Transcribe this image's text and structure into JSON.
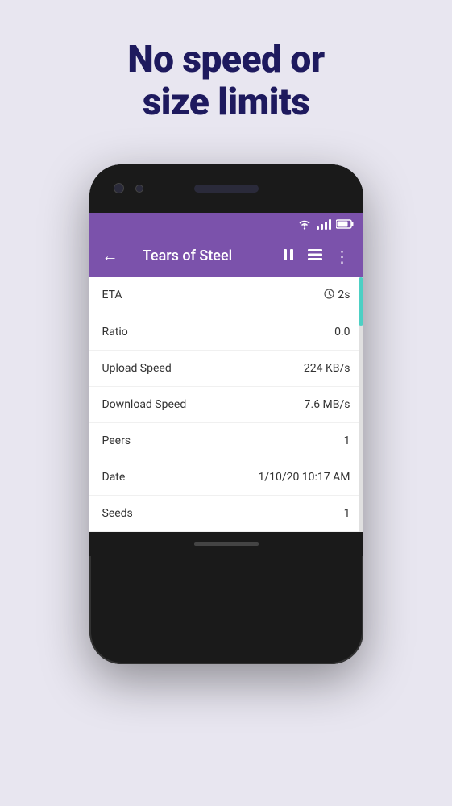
{
  "page": {
    "background_color": "#e8e6f0",
    "headline": {
      "line1": "No speed or",
      "line2": "size limits",
      "color": "#1e1a5e"
    }
  },
  "phone": {
    "app_bar": {
      "title": "Tears of Steel",
      "back_label": "←",
      "pause_label": "⏸",
      "list_label": "≡",
      "more_label": "⋮",
      "background": "#7b52ab"
    },
    "info_rows": [
      {
        "label": "ETA",
        "value": "2s",
        "has_clock": true
      },
      {
        "label": "Ratio",
        "value": "0.0",
        "has_clock": false
      },
      {
        "label": "Upload Speed",
        "value": "224 KB/s",
        "has_clock": false
      },
      {
        "label": "Download Speed",
        "value": "7.6 MB/s",
        "has_clock": false
      },
      {
        "label": "Peers",
        "value": "1",
        "has_clock": false
      },
      {
        "label": "Date",
        "value": "1/10/20 10:17 AM",
        "has_clock": false
      },
      {
        "label": "Seeds",
        "value": "1",
        "has_clock": false
      }
    ]
  }
}
